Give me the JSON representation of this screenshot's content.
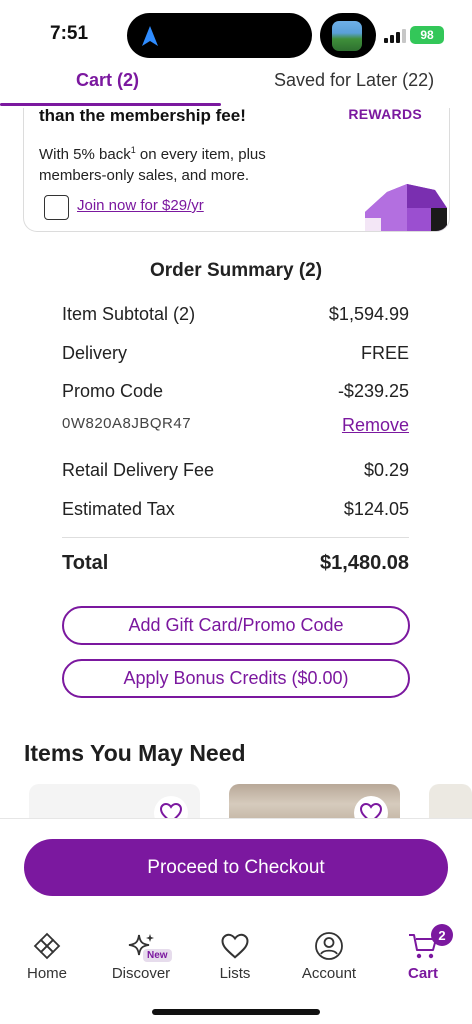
{
  "status_bar": {
    "time": "7:51",
    "battery": "98"
  },
  "tabs": {
    "cart": "Cart (2)",
    "saved": "Saved for Later (22)"
  },
  "membership": {
    "headline": "than the membership fee!",
    "badge": "REWARDS",
    "body_pre": "With 5% back",
    "footnote": "1",
    "body_post": " on every item, plus members-only sales, and more.",
    "join_link": "Join now for $29/yr"
  },
  "summary": {
    "title": "Order Summary (2)",
    "rows": {
      "subtotal": {
        "label": "Item Subtotal (2)",
        "value": "$1,594.99"
      },
      "delivery": {
        "label": "Delivery",
        "value": "FREE"
      },
      "promo": {
        "label": "Promo Code",
        "value": "-$239.25"
      },
      "promo_code": {
        "label": "0W820A8JBQR47",
        "value": "Remove"
      },
      "retail_fee": {
        "label": "Retail Delivery Fee",
        "value": "$0.29"
      },
      "tax": {
        "label": "Estimated Tax",
        "value": "$124.05"
      },
      "total": {
        "label": "Total",
        "value": "$1,480.08"
      }
    },
    "gift_button": "Add Gift Card/Promo Code",
    "bonus_button": "Apply Bonus Credits ($0.00)"
  },
  "recommendations": {
    "title": "Items You May Need"
  },
  "checkout": {
    "label": "Proceed to Checkout"
  },
  "bottom_nav": {
    "home": "Home",
    "discover": "Discover",
    "discover_badge": "New",
    "lists": "Lists",
    "account": "Account",
    "cart": "Cart",
    "cart_count": "2"
  },
  "colors": {
    "brand": "#7b189f",
    "battery": "#33c759"
  },
  "icons": [
    "navigation-arrow-icon",
    "signal-icon",
    "home-icon",
    "sparkle-icon",
    "heart-icon",
    "account-icon",
    "cart-icon"
  ]
}
